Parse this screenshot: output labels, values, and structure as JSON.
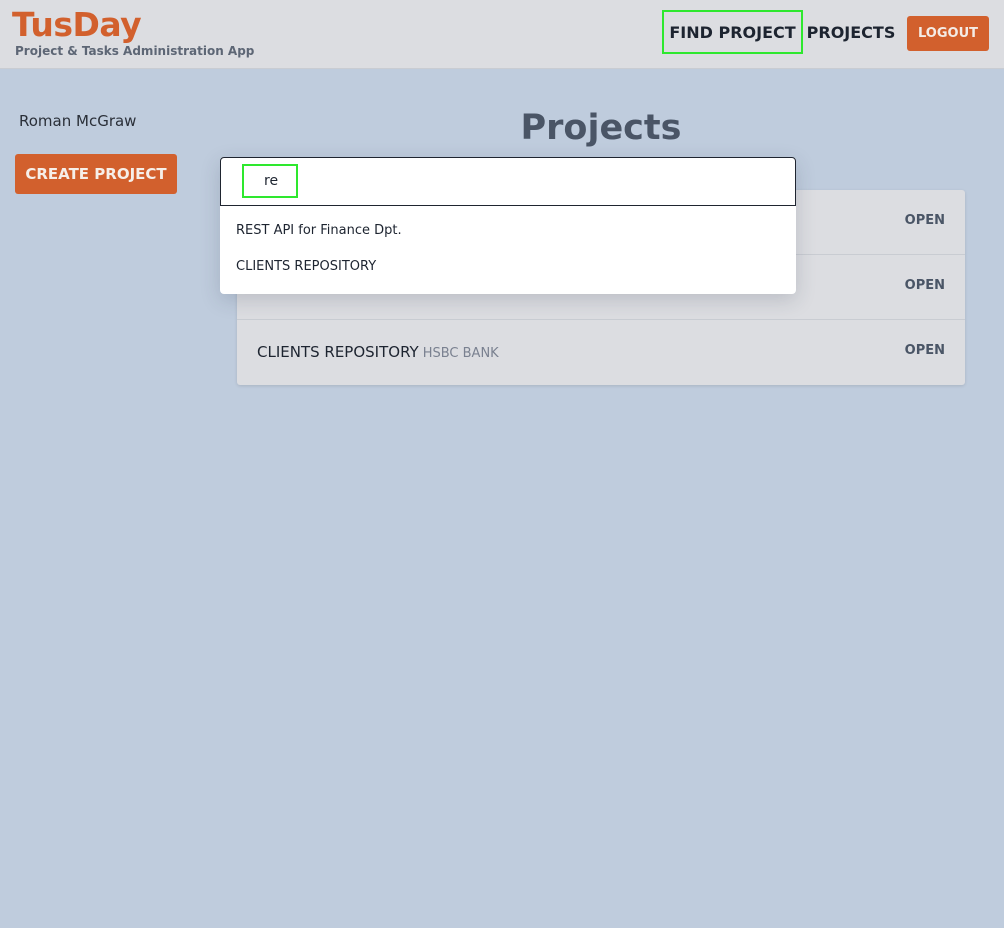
{
  "header": {
    "app_title": "TusDay",
    "app_subtitle": "Project & Tasks Administration App",
    "nav": {
      "find_project": "FIND PROJECT",
      "projects": "PROJECTS",
      "logout": "LOGOUT"
    }
  },
  "sidebar": {
    "username": "Roman McGraw",
    "create_project": "CREATE PROJECT"
  },
  "main": {
    "title": "Projects",
    "projects": [
      {
        "name": "",
        "client": "",
        "action": "OPEN"
      },
      {
        "name": "",
        "client": "",
        "action": "OPEN"
      },
      {
        "name": "CLIENTS REPOSITORY",
        "client": "HSBC BANK",
        "action": "OPEN"
      }
    ]
  },
  "search": {
    "value": "re",
    "results": [
      "REST API for Finance Dpt.",
      "CLIENTS REPOSITORY"
    ]
  },
  "colors": {
    "accent": "#d2602d",
    "background": "#bfccdd",
    "header": "#dcdde1",
    "highlight": "#2ee82e"
  }
}
